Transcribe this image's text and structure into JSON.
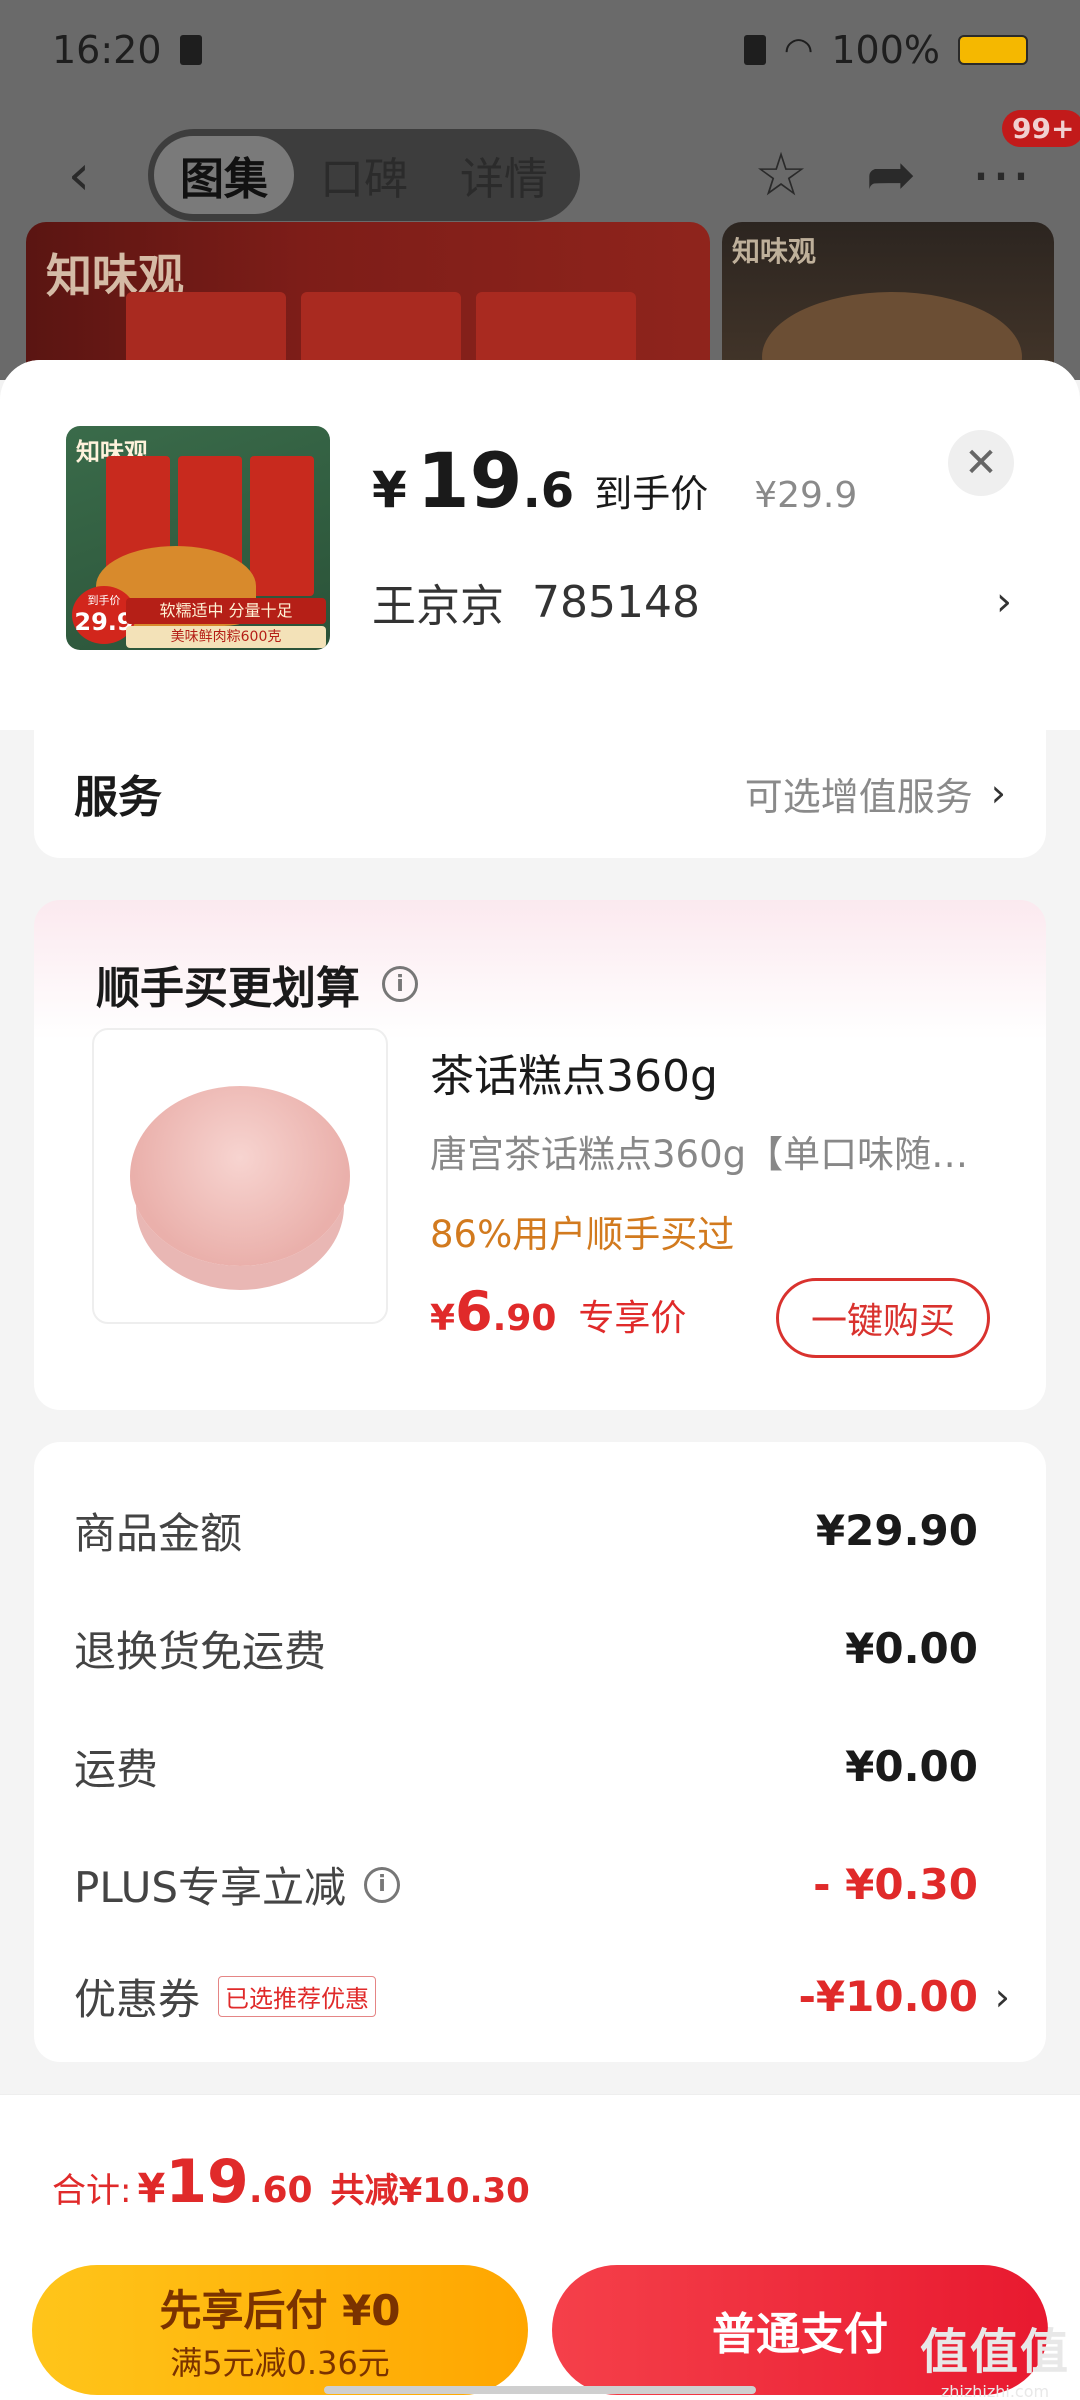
{
  "status_bar": {
    "time": "16:20",
    "battery_pct": "100%"
  },
  "nav": {
    "tabs": [
      {
        "label": "图集",
        "active": true
      },
      {
        "label": "口碑",
        "active": false
      },
      {
        "label": "详情",
        "active": false
      }
    ],
    "more_badge": "99+"
  },
  "gallery": {
    "logo_1": "知味观",
    "logo_2": "知味观"
  },
  "product": {
    "thumb_logo": "知味观",
    "thumb_badge_label": "到手价",
    "thumb_badge_price": "29.9",
    "thumb_strip_1": "软糯适中 分量十足",
    "thumb_strip_2": "美味鲜肉粽600克",
    "price_symbol": "¥",
    "price_int": "19",
    "price_dec": ".6",
    "price_label": "到手价",
    "original_price": "¥29.9",
    "recipient_name": "王京京",
    "recipient_code": "785148"
  },
  "service": {
    "title": "服务",
    "value": "可选增值服务"
  },
  "combo": {
    "title": "顺手买更划算",
    "item_name": "茶话糕点360g",
    "item_desc": "唐宫茶话糕点360g【单口味随…",
    "stat": "86%用户顺手买过",
    "price_symbol": "¥",
    "price_int": "6",
    "price_dec": ".90",
    "price_label": "专享价",
    "buy_label": "一键购买"
  },
  "summary": {
    "rows": [
      {
        "label": "商品金额",
        "value": "¥29.90"
      },
      {
        "label": "退换货免运费",
        "value": "¥0.00"
      },
      {
        "label": "运费",
        "value": "¥0.00"
      },
      {
        "label": "PLUS专享立减",
        "value": "- ¥0.30"
      },
      {
        "label": "优惠券",
        "tag": "已选推荐优惠",
        "value": "-¥10.00"
      }
    ]
  },
  "footer": {
    "total_label": "合计:",
    "total_symbol": "¥",
    "total_int": "19",
    "total_dec": ".60",
    "saved": "共减¥10.30",
    "pay_later_title": "先享后付 ¥0",
    "pay_later_sub": "满5元减0.36元",
    "pay_normal": "普通支付"
  },
  "watermark": {
    "line1": "值值值",
    "line2": "zhizhizhi.com"
  },
  "colors": {
    "accent_red": "#e02a2a",
    "pay_later_yellow": "#ffb800",
    "pay_normal_red": "#ef2b3b",
    "stat_orange": "#d27a1e"
  }
}
